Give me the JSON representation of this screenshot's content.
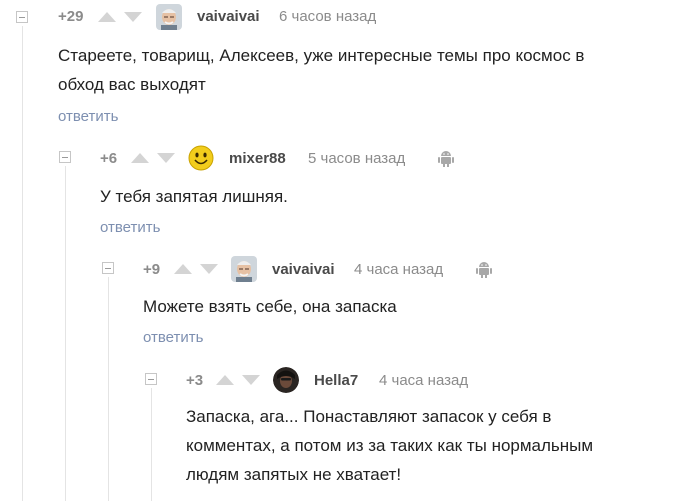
{
  "comments": [
    {
      "rating": "+29",
      "username": "vaivaivai",
      "time": "6 часов назад",
      "text_lines": [
        "Стареете, товарищ, Алексеев, уже интересные темы про космос в",
        "обход вас выходят"
      ],
      "reply_label": "ответить",
      "avatar_icon": "avatar-elderly-man",
      "platform_icon": null
    },
    {
      "rating": "+6",
      "username": "mixer88",
      "time": "5 часов назад",
      "text_lines": [
        "У тебя запятая лишняя."
      ],
      "reply_label": "ответить",
      "avatar_icon": "avatar-smiley",
      "platform_icon": "android-icon"
    },
    {
      "rating": "+9",
      "username": "vaivaivai",
      "time": "4 часа назад",
      "text_lines": [
        "Можете взять себе, она запаска"
      ],
      "reply_label": "ответить",
      "avatar_icon": "avatar-elderly-man",
      "platform_icon": "android-icon"
    },
    {
      "rating": "+3",
      "username": "Hella7",
      "time": "4 часа назад",
      "text_lines": [
        "Запаска, ага... Понаставляют запасок у себя в",
        "комментах, а потом из за таких как ты нормальным",
        "людям запятых не хватает!"
      ],
      "reply_label": null,
      "avatar_icon": "avatar-dark-portrait",
      "platform_icon": null
    }
  ],
  "colors": {
    "reply_link": "#7d8fb0",
    "meta_gray": "#8b8b8b",
    "arrow_gray": "#d4d4d4",
    "thread_line": "#e4e4e4"
  }
}
